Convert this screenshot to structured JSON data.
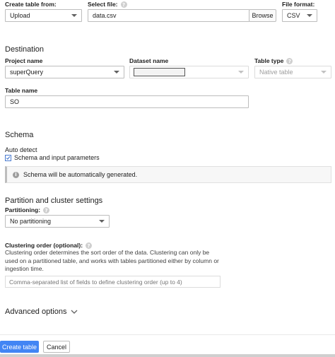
{
  "source": {
    "create_from_label": "Create table from:",
    "create_from_value": "Upload",
    "select_file_label": "Select file:",
    "file_value": "data.csv",
    "browse_label": "Browse",
    "file_format_label": "File format:",
    "file_format_value": "CSV"
  },
  "destination": {
    "heading": "Destination",
    "project_label": "Project name",
    "project_value": "superQuery",
    "dataset_label": "Dataset name",
    "table_type_label": "Table type",
    "table_type_value": "Native table",
    "table_name_label": "Table name",
    "table_name_value": "SO"
  },
  "schema": {
    "heading": "Schema",
    "auto_detect_label": "Auto detect",
    "checkbox_label": "Schema and input parameters",
    "checked": true,
    "info_text": "Schema will be automatically generated."
  },
  "partition": {
    "heading": "Partition and cluster settings",
    "partitioning_label": "Partitioning:",
    "partitioning_value": "No partitioning",
    "clustering_label": "Clustering order (optional):",
    "clustering_description": "Clustering order determines the sort order of the data. Clustering can only be used on a partitioned table, and works with tables partitioned either by column or ingestion time.",
    "clustering_placeholder": "Comma-separated list of fields to define clustering order (up to 4)"
  },
  "advanced": {
    "label": "Advanced options"
  },
  "footer": {
    "create_label": "Create table",
    "cancel_label": "Cancel"
  },
  "colors": {
    "primary": "#4285f4",
    "info_icon": "#9e9e9e",
    "check": "#4a7bd0"
  }
}
